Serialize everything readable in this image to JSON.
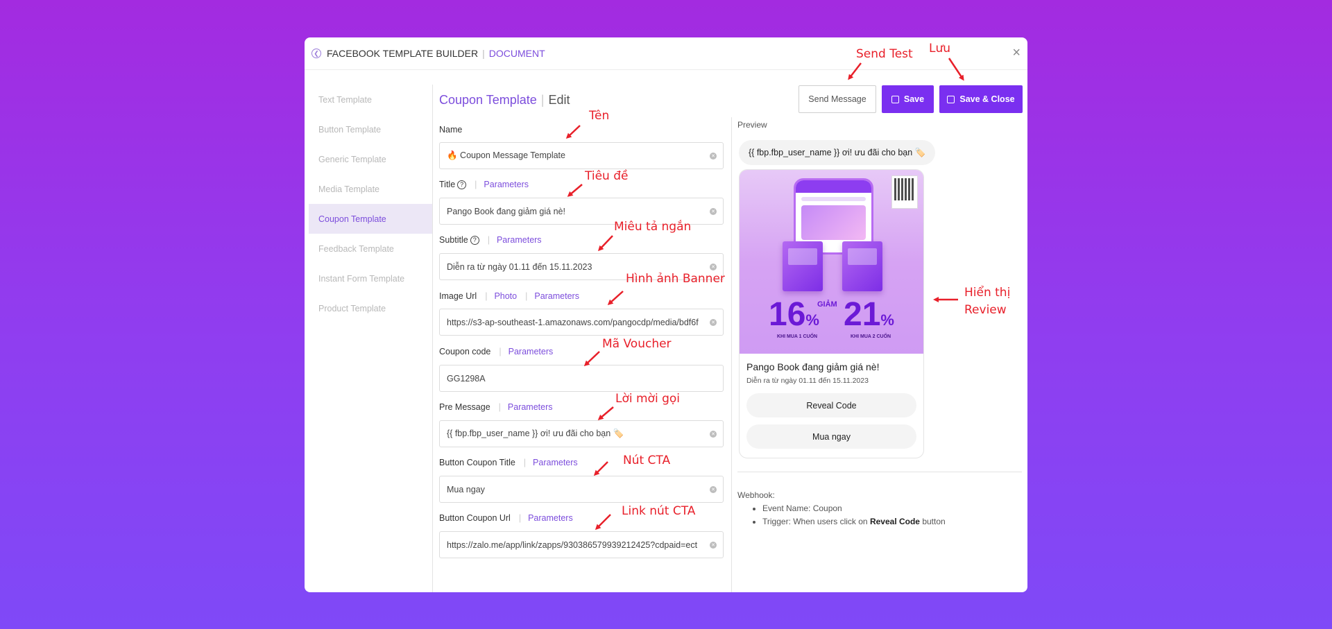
{
  "header": {
    "title": "FACEBOOK TEMPLATE BUILDER",
    "document": "DOCUMENT"
  },
  "sidebar": {
    "items": [
      {
        "label": "Text Template"
      },
      {
        "label": "Button Template"
      },
      {
        "label": "Generic Template"
      },
      {
        "label": "Media Template"
      },
      {
        "label": "Coupon Template",
        "active": true
      },
      {
        "label": "Feedback Template"
      },
      {
        "label": "Instant Form Template"
      },
      {
        "label": "Product Template"
      }
    ]
  },
  "form": {
    "title": "Coupon Template",
    "mode": "Edit",
    "parameters_link": "Parameters",
    "photo_link": "Photo",
    "fields": {
      "name": {
        "label": "Name",
        "value": "🔥 Coupon Message Template"
      },
      "title": {
        "label": "Title",
        "value": "Pango Book đang giảm giá nè!"
      },
      "subtitle": {
        "label": "Subtitle",
        "value": "Diễn ra từ ngày 01.11 đến 15.11.2023"
      },
      "image_url": {
        "label": "Image Url",
        "value": "https://s3-ap-southeast-1.amazonaws.com/pangocdp/media/bdf6f"
      },
      "coupon_code": {
        "label": "Coupon code",
        "value": "GG1298A"
      },
      "pre_message": {
        "label": "Pre Message",
        "value": "{{ fbp.fbp_user_name }} ơi! ưu đãi cho bạn 🏷️"
      },
      "button_coupon_title": {
        "label": "Button Coupon Title",
        "value": "Mua ngay"
      },
      "button_coupon_url": {
        "label": "Button Coupon Url",
        "value": "https://zalo.me/app/link/zapps/930386579939212425?cdpaid=ect"
      }
    }
  },
  "actions": {
    "send_message": "Send Message",
    "save": "Save",
    "save_close": "Save & Close"
  },
  "preview": {
    "label": "Preview",
    "pre_message": "{{ fbp.fbp_user_name }} ơi! ưu đãi cho bạn 🏷️",
    "banner": {
      "pct1": "16",
      "pct2": "21",
      "percent_sign": "%",
      "giam": "GIẢM",
      "khi1": "KHI MUA 1 CUỐN",
      "khi2": "KHI MUA 2 CUỐN"
    },
    "card_title": "Pango Book đang giảm giá nè!",
    "card_subtitle": "Diễn ra từ ngày 01.11 đến 15.11.2023",
    "reveal_button": "Reveal Code",
    "buy_button": "Mua ngay"
  },
  "webhook": {
    "label": "Webhook:",
    "event": "Event Name: Coupon",
    "trigger_prefix": "Trigger: When users click on",
    "trigger_bold": "Reveal Code",
    "trigger_suffix": "button"
  },
  "annotations": {
    "send_test": "Send Test",
    "luu": "Lưu",
    "ten": "Tên",
    "tieu_de": "Tiêu đề",
    "mieu_ta": "Miêu tả ngắn",
    "hinh_anh": "Hình ảnh Banner",
    "ma_voucher": "Mã Voucher",
    "loi_moi": "Lời mời gọi",
    "nut_cta": "Nút CTA",
    "link_cta": "Link nút CTA",
    "hien_thi": "Hiển thị",
    "review": "Review"
  },
  "colors": {
    "accent": "#7a2ff0",
    "annotation": "#e8202a"
  }
}
